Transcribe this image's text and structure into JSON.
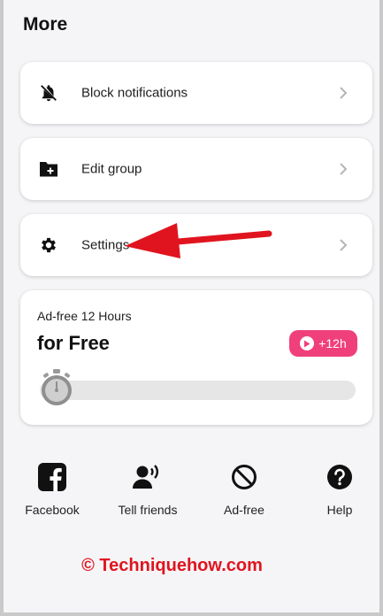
{
  "header": {
    "title": "More"
  },
  "menu": [
    {
      "label": "Block notifications",
      "icon": "bell-off-icon"
    },
    {
      "label": "Edit group",
      "icon": "folder-add-icon"
    },
    {
      "label": "Settings",
      "icon": "gear-icon"
    }
  ],
  "ad": {
    "subtitle": "Ad-free 12 Hours",
    "title": "for Free",
    "badge": "+12h",
    "progress_percent": 0,
    "accent": "#f0407b"
  },
  "bottom": [
    {
      "label": "Facebook",
      "icon": "facebook-icon"
    },
    {
      "label": "Tell friends",
      "icon": "share-voice-icon"
    },
    {
      "label": "Ad-free",
      "icon": "block-icon"
    },
    {
      "label": "Help",
      "icon": "help-icon"
    }
  ],
  "watermark": "© Techniquehow.com",
  "annotation_color": "#e0141e"
}
